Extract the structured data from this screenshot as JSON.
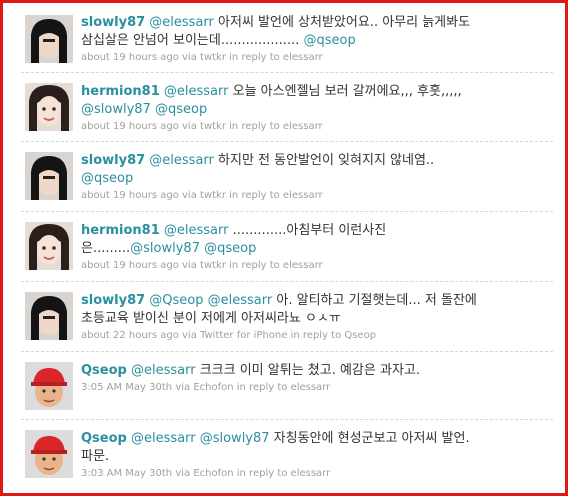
{
  "tweets": [
    {
      "user": "slowly87",
      "line1_mention": "@elessarr",
      "line1_text": " 아저씨 발언에 상처받았어요.. 아무리 늙게봐도",
      "line2_text": "삼십살은 안넘어 보이는데................... ",
      "line2_mention": "@qseop",
      "time": "about 19 hours ago",
      "via_word": "via",
      "client": "twtkr",
      "in_reply_to": "in reply to elessarr",
      "avatar_icon": "dark-hair-girl-avatar"
    },
    {
      "user": "hermion81",
      "line1_mention": "@elessarr",
      "line1_text": " 오늘 아스엔젤님 보러 갈꺼에요,,, 후훗,,,,,",
      "line2_mention1": "@slowly87",
      "line2_mention2": "@qseop",
      "time": "about 19 hours ago",
      "via_word": "via",
      "client": "twtkr",
      "in_reply_to": "in reply to elessarr",
      "avatar_icon": "smiling-woman-avatar"
    },
    {
      "user": "slowly87",
      "line1_mention": "@elessarr",
      "line1_text": " 하지만 전 동안발언이 잊혀지지 않네염..",
      "line2_mention": "@qseop",
      "time": "about 19 hours ago",
      "via_word": "via",
      "client": "twtkr",
      "in_reply_to": "in reply to elessarr",
      "avatar_icon": "dark-hair-girl-avatar"
    },
    {
      "user": "hermion81",
      "line1_mention": "@elessarr",
      "line1_text": " .............아침부터 이런사진",
      "line2_text": "은.........",
      "line2_mention1": "@slowly87",
      "line2_mention2": "@qseop",
      "time": "about 19 hours ago",
      "via_word": "via",
      "client": "twtkr",
      "in_reply_to": "in reply to elessarr",
      "avatar_icon": "smiling-woman-avatar"
    },
    {
      "user": "slowly87",
      "line1_mention1": "@Qseop",
      "line1_mention2": "@elessarr",
      "line1_text": " 아. 알티하고 기절햇는데... 저 돌잔에",
      "line2_text": "초등교육 받이신 분이 저에게 아저씨라뇨 ㅇㅅㅠ",
      "time": "about 22 hours ago",
      "via_word": "via",
      "client": "Twitter for iPhone",
      "in_reply_to": "in reply to Qseop",
      "avatar_icon": "dark-hair-girl-avatar"
    },
    {
      "user": "Qseop",
      "line1_mention": "@elessarr",
      "line1_text": " 크크크 이미 알튀는 쳤고. 예감은 과자고.",
      "time": "3:05 AM May 30th",
      "via_word": "via",
      "client": "Echofon",
      "in_reply_to": "in reply to elessarr",
      "avatar_icon": "red-cap-man-avatar"
    },
    {
      "user": "Qseop",
      "line1_mention1": "@elessarr",
      "line1_mention2": "@slowly87",
      "line1_text": " 자칭동안에 현성군보고 아저씨 발언.",
      "line2_text": "파문.",
      "time": "3:03 AM May 30th",
      "via_word": "via",
      "client": "Echofon",
      "in_reply_to": "in reply to elessarr",
      "avatar_icon": "red-cap-man-avatar"
    }
  ],
  "colors": {
    "frame_border": "#e01818",
    "link": "#2a8f9e",
    "meta": "#a0a0a0",
    "text": "#333333"
  }
}
